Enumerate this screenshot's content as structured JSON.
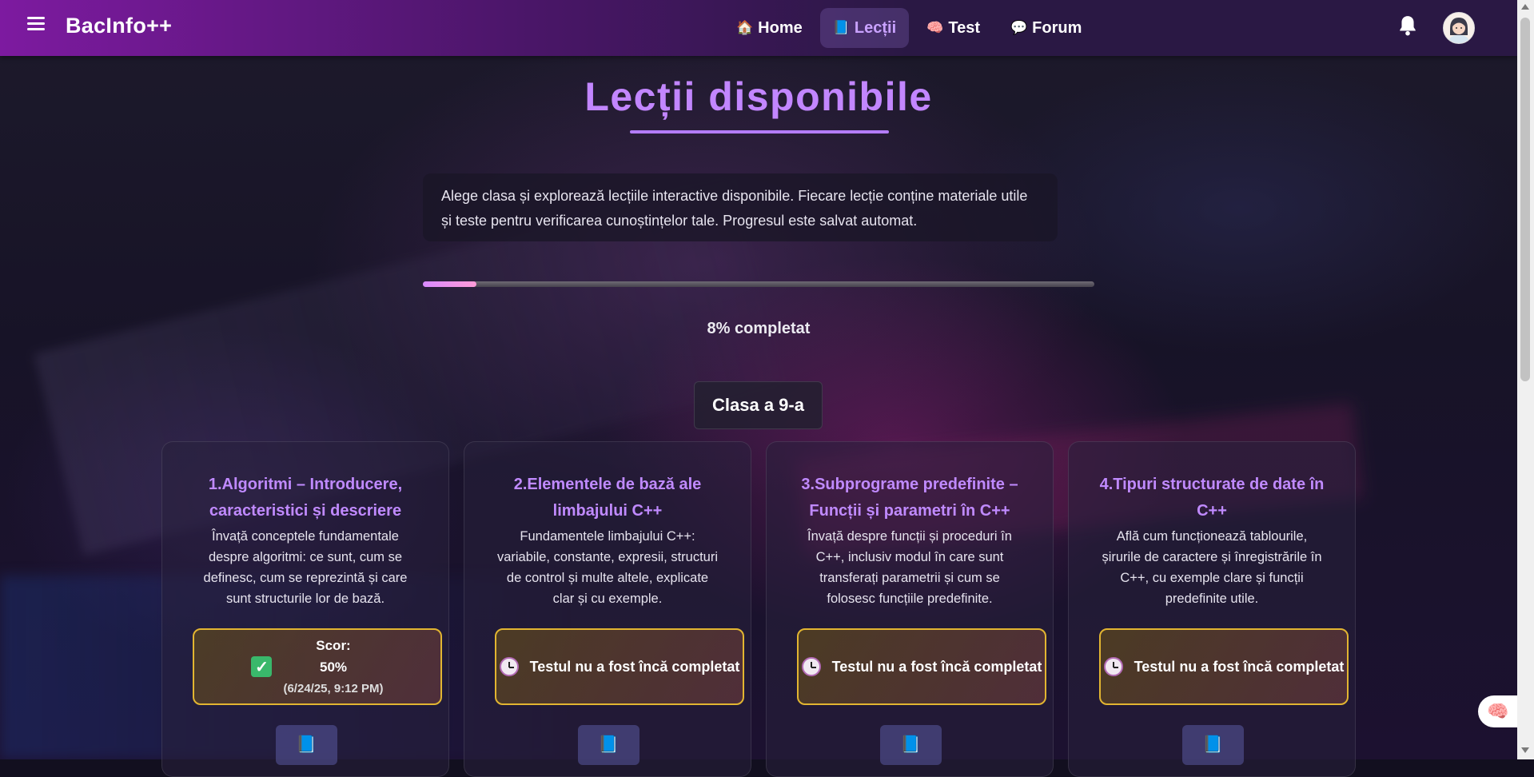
{
  "header": {
    "brand": "BacInfo++",
    "nav": [
      {
        "icon": "🏠",
        "label": "Home"
      },
      {
        "icon": "📘",
        "label": "Lecții"
      },
      {
        "icon": "🧠",
        "label": "Test"
      },
      {
        "icon": "💬",
        "label": "Forum"
      }
    ],
    "active_nav": "Lecții"
  },
  "main": {
    "title": "Lecții disponibile",
    "intro": "Alege clasa și explorează lecțiile interactive disponibile. Fiecare lecție conține materiale utile și teste pentru verificarea cunoștințelor tale. Progresul este salvat automat.",
    "progress_percent": 8,
    "progress_text": "8% completat",
    "class_button": "Clasa a 9-a",
    "lessons": [
      {
        "title": "1.Algoritmi – Introducere, caracteristici și descriere",
        "description": "Învață conceptele fundamentale despre algoritmi: ce sunt, cum se definesc, cum se reprezintă și care sunt structurile lor de bază.",
        "score_label": "Scor:",
        "score": "50%",
        "score_date": "(6/24/25, 9:12 PM)"
      },
      {
        "title": "2.Elementele de bază ale limbajului C++",
        "description": "Fundamentele limbajului C++: variabile, constante, expresii, structuri de control și multe altele, explicate clar și cu exemple.",
        "status": "Testul nu a fost încă completat"
      },
      {
        "title": "3.Subprograme predefinite – Funcții și parametri în C++",
        "description": "Învață despre funcții și proceduri în C++, inclusiv modul în care sunt transferați parametrii și cum se folosesc funcțiile predefinite.",
        "status": "Testul nu a fost încă completat"
      },
      {
        "title": "4.Tipuri structurate de date în C++",
        "description": "Află cum funcționează tablourile, șirurile de caractere și înregistrările în C++, cu exemple clare și funcții predefinite utile.",
        "status": "Testul nu a fost încă completat"
      }
    ],
    "book_icon": "📘",
    "check_icon": "✓"
  },
  "colors": {
    "accent": "#c286ff",
    "status_border": "#e2b531",
    "check": "#39b86b"
  }
}
